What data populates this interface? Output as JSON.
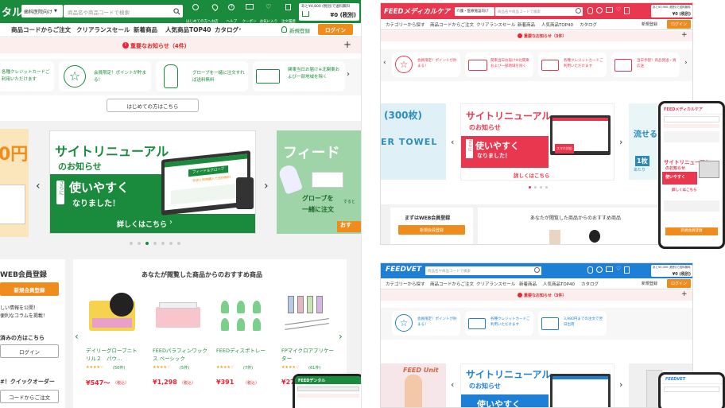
{
  "dental": {
    "logo": "タル",
    "category_select": "歯科医院向け",
    "search_placeholder": "商品名や商品コードで検索",
    "header_icons": [
      "はじめての方へ",
      "お店",
      "ヘルプ",
      "クーポン",
      "お気に入り",
      "注文履歴"
    ],
    "cart_notice": "あと¥4,800 (税別)で送料無料",
    "cart_amount": "¥0 (税別)",
    "nav": [
      "商品コードからご注文",
      "クリアランスセール",
      "新着商品",
      "人気商品TOP40",
      "カタログ"
    ],
    "register": "新規登録",
    "login": "ログイン",
    "notice": "重要なお知らせ（4件）",
    "features": [
      "各種クレジットカードご利用いただけます",
      "会員限定！ポイントが貯まる！",
      "グローブを一緒に注文すれば送料無料",
      "関東当日お届け※北関東および一部地域を除く"
    ],
    "first_time_button": "はじめての方はこちら",
    "banner": {
      "title": "サイトリニューアル",
      "subtitle": "のお知らせ",
      "badge": "さらに",
      "big1": "使いやすく",
      "big2": "なりました！",
      "cta": "詳しくはこちら",
      "screen_tag": "フィード＆グローブ",
      "screen_sub": "手袋と同時購入で送料無料"
    },
    "side_banner": {
      "title": "フィード",
      "sub1": "グローブを",
      "sub2": "一緒に注文",
      "sub3": "すると",
      "cta": "おす"
    },
    "left_promo": {
      "text": "0円",
      "chip": "料"
    },
    "web_register_title": "WEB会員登録",
    "register_button": "新規会員登録",
    "register_desc": [
      "しい情報を公開！",
      "便利なコラムを掲載！"
    ],
    "member_heading": "済みの方はこちら",
    "member_login": "ログイン",
    "quick_order_title": "#！クイックオーダー",
    "quick_order_button": "コードからご注文",
    "rec_title": "あなたが閲覧した商品からのおすすめ商品",
    "products": [
      {
        "name": "デイリーグローブニトリル２　パウ…",
        "reviews": "(50件)",
        "price": "¥547〜",
        "tax": "（税込）"
      },
      {
        "name": "FEEDパラフィンワックス ベーシック",
        "reviews": "(5件)",
        "price": "¥1,298",
        "tax": "（税込）"
      },
      {
        "name": "FEEDディスポトレー",
        "reviews": "(7件)",
        "price": "¥391",
        "tax": "（税込）"
      },
      {
        "name": "FPマイクロアプリケーター",
        "reviews": "(61件)",
        "price": "¥27",
        "tax": ""
      }
    ],
    "mobile_logo": "FEEDデンタル"
  },
  "medical": {
    "logo": "FEEDメディカルケア",
    "category_select": "介護・医療施設向け",
    "search_placeholder": "商品名や商品コードで検索",
    "cart_notice": "あと¥3,900 (税別)で送料無料",
    "cart_amount": "¥0 (税別)",
    "nav": [
      "カテゴリーから探す",
      "商品コードからご注文",
      "クリアランスセール",
      "新着商品",
      "人気商品TOP40",
      "カタログ"
    ],
    "register": "新規登録",
    "login": "ログイン",
    "notice": "重要なお知らせ（3件）",
    "features": [
      "会員限定！ポイントが貯まる！",
      "関東当日お届け※北関東および一部地域を除く",
      "各種クレジットカードご利用いただけます",
      "当日手配！商品発送・貢広送"
    ],
    "left_banner": "(300枚)",
    "left_banner2": "ER TOWEL",
    "banner": {
      "title": "サイトリニューアル",
      "subtitle": "のお知らせ",
      "badge": "さらに",
      "big1": "使いやすく",
      "big2": "なりました！",
      "cta": "詳しくはこちら",
      "tag": "スマホ対応"
    },
    "side_banner": {
      "t1": "流せる",
      "t2": "1枚",
      "t3": "あたり"
    },
    "web_register_title": "まずはWEB会員登録",
    "register_button": "新規会員登録",
    "rec_title": "あなたが閲覧した商品からのおすすめ商品",
    "mobile": {
      "logo": "FEEDメディカルケア",
      "title": "サイトリニューアル",
      "subtitle": "のお知らせ",
      "big": "使いやすく",
      "cta": "詳しくはこちら",
      "register": "新規会員登録"
    }
  },
  "vet": {
    "logo": "FEEDVET",
    "search_placeholder": "商品名や商品コードで検索",
    "cart_notice": "あと¥5,000 (税別)で送料無料",
    "cart_amount": "¥0 (税別)",
    "nav": [
      "カテゴリーから探す",
      "商品コードからご注文",
      "クリアランスセール",
      "新着商品",
      "人気商品TOP40",
      "カタログ"
    ],
    "register": "新規登録",
    "login": "ログイン",
    "notice": "重要なお知らせ（3件）",
    "features": [
      "会員限定！ポイントが貯まる！",
      "各種クレジットカードご利用いただけます",
      "3,980円までの注文で翌日出荷"
    ],
    "left_banner": "FEED Unit",
    "banner": {
      "title": "サイトリニューアル",
      "subtitle": "のお知らせ",
      "big": "使いやすく"
    },
    "mobile_logo": "FEEDVET"
  },
  "colors": {
    "dental": "#1a8a3c",
    "medical": "#e8374f",
    "vet": "#1e7fd6",
    "orange": "#f08c1e",
    "notice_bg": "#fdeeee"
  }
}
